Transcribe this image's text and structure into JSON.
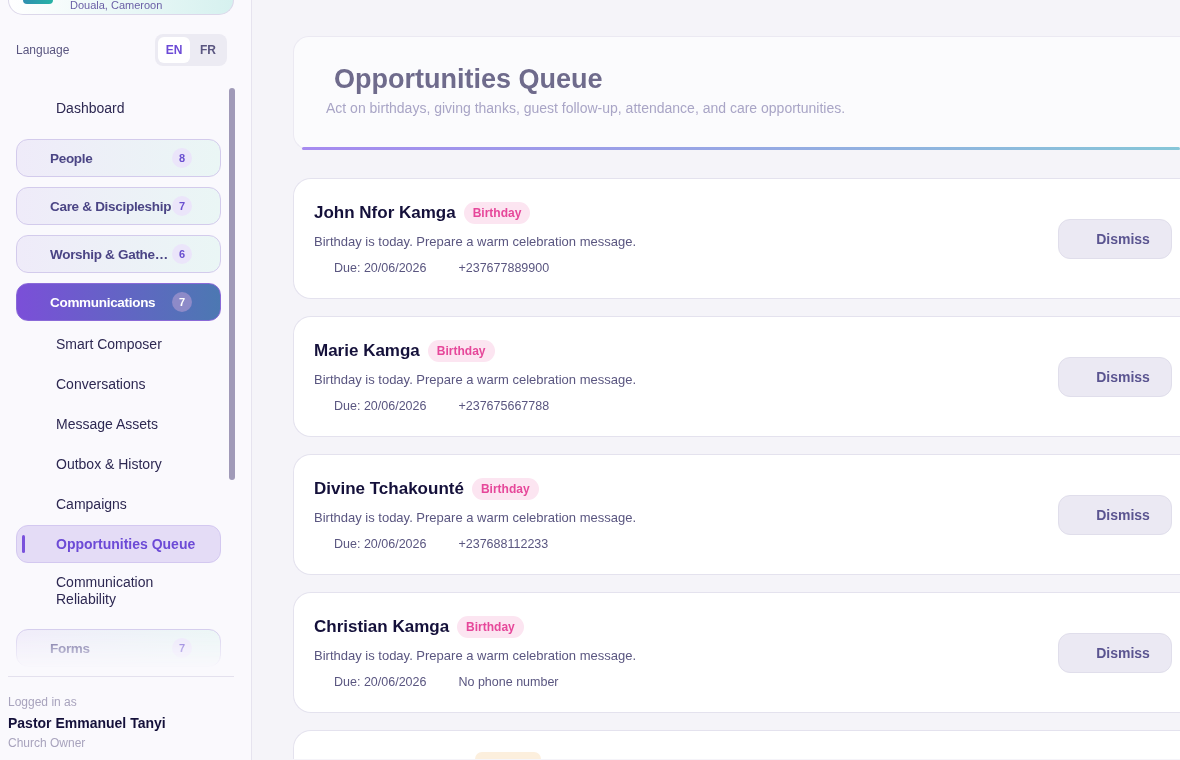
{
  "org_card": {
    "location": "Douala, Cameroon"
  },
  "language": {
    "label": "Language",
    "options": [
      {
        "label": "EN",
        "selected": true
      },
      {
        "label": "FR",
        "selected": false
      }
    ]
  },
  "nav": [
    {
      "kind": "link",
      "label": "Dashboard",
      "selected": false
    },
    {
      "kind": "group",
      "label": "People",
      "count": "8",
      "expanded": false
    },
    {
      "kind": "group",
      "label": "Care & Discipleship",
      "count": "7",
      "expanded": false
    },
    {
      "kind": "group",
      "label": "Worship & Gathe…",
      "count": "6",
      "expanded": false
    },
    {
      "kind": "group",
      "label": "Communications",
      "count": "7",
      "expanded": true,
      "children": [
        {
          "label": "Smart Composer",
          "selected": false
        },
        {
          "label": "Conversations",
          "selected": false
        },
        {
          "label": "Message Assets",
          "selected": false
        },
        {
          "label": "Outbox & History",
          "selected": false
        },
        {
          "label": "Campaigns",
          "selected": false
        },
        {
          "label": "Opportunities Queue",
          "selected": true
        },
        {
          "label": "Communication Reliability",
          "selected": false
        }
      ]
    },
    {
      "kind": "group",
      "label": "Forms",
      "count": "7",
      "expanded": false
    }
  ],
  "user": {
    "caption": "Logged in as",
    "name": "Pastor Emmanuel Tanyi",
    "role": "Church Owner"
  },
  "header": {
    "title": "Opportunities Queue",
    "subtitle": "Act on birthdays, giving thanks, guest follow-up, attendance, and care opportunities."
  },
  "opportunities": [
    {
      "kind": "card",
      "name": "John Nfor Kamga",
      "tag": "Birthday",
      "color": "#e6479a",
      "description": "Birthday is today. Prepare a warm celebration message.",
      "due": "Due: 20/06/2026",
      "phone": "+237677889900",
      "action": "Dismiss"
    },
    {
      "kind": "card",
      "name": "Marie Kamga",
      "tag": "Birthday",
      "color": "#e6479a",
      "description": "Birthday is today. Prepare a warm celebration message.",
      "due": "Due: 20/06/2026",
      "phone": "+237675667788",
      "action": "Dismiss"
    },
    {
      "kind": "card",
      "name": "Divine Tchakounté",
      "tag": "Birthday",
      "color": "#e6479a",
      "description": "Birthday is today. Prepare a warm celebration message.",
      "due": "Due: 20/06/2026",
      "phone": "+237688112233",
      "action": "Dismiss"
    },
    {
      "kind": "card",
      "name": "Christian Kamga",
      "tag": "Birthday",
      "color": "#e6479a",
      "description": "Birthday is today. Prepare a warm celebration message.",
      "due": "Due: 20/06/2026",
      "phone": "No phone number",
      "action": "Dismiss"
    },
    {
      "kind": "cut",
      "color": "#fcefdd"
    }
  ]
}
